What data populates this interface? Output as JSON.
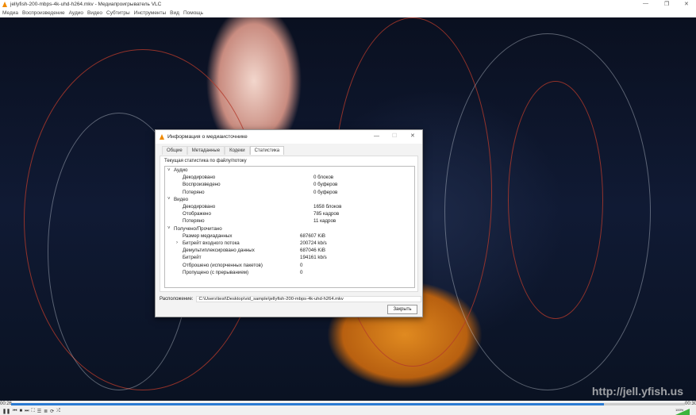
{
  "window": {
    "title": "jellyfish-200-mbps-4k-uhd-h264.mkv - Медиапроигрыватель VLC",
    "minimize": "—",
    "maximize": "❐",
    "close": "✕"
  },
  "menu": [
    "Медиа",
    "Воспроизведение",
    "Аудио",
    "Видео",
    "Субтитры",
    "Инструменты",
    "Вид",
    "Помощь"
  ],
  "video": {
    "watermark": "http://jell.yfish.us"
  },
  "player": {
    "elapsed": "00:26",
    "total": "00:30",
    "progress": 0.88,
    "volume": "100%",
    "accent": "#2a7ad2"
  },
  "dialog": {
    "title": "Информация о медиаисточнике",
    "tabs": [
      "Общие",
      "Метаданные",
      "Кодеки",
      "Статистика"
    ],
    "active_tab": 3,
    "label": "Текущая статистика по файлу/потоку",
    "groups": [
      {
        "name": "Аудио",
        "rows": [
          [
            "Декодировано",
            "0 блоков"
          ],
          [
            "Воспроизведено",
            "0 буферов"
          ],
          [
            "Потеряно",
            "0 буферов"
          ]
        ]
      },
      {
        "name": "Видео",
        "rows": [
          [
            "Декодировано",
            "1658 блоков"
          ],
          [
            "Отображено",
            "785 кадров"
          ],
          [
            "Потеряно",
            "11 кадров"
          ]
        ]
      },
      {
        "name": "Получено/Прочитано",
        "rows": [
          [
            "Размер медиаданных",
            "687607 KiB"
          ],
          [
            "Битрейт входного потока",
            "200724 kb/s"
          ],
          [
            "Демультиплексировано данных",
            "687046 KiB"
          ],
          [
            "Битрейт",
            "194161 kb/s"
          ],
          [
            "Отброшено (испорченных пакетов)",
            "0"
          ],
          [
            "Пропущено (с прерыванием)",
            "0"
          ]
        ]
      }
    ],
    "location_label": "Расположение:",
    "location_value": "C:\\Users\\test\\Desktop\\vid_sample\\jellyfish-200-mbps-4k-uhd-h264.mkv",
    "close_button": "Закрыть"
  }
}
